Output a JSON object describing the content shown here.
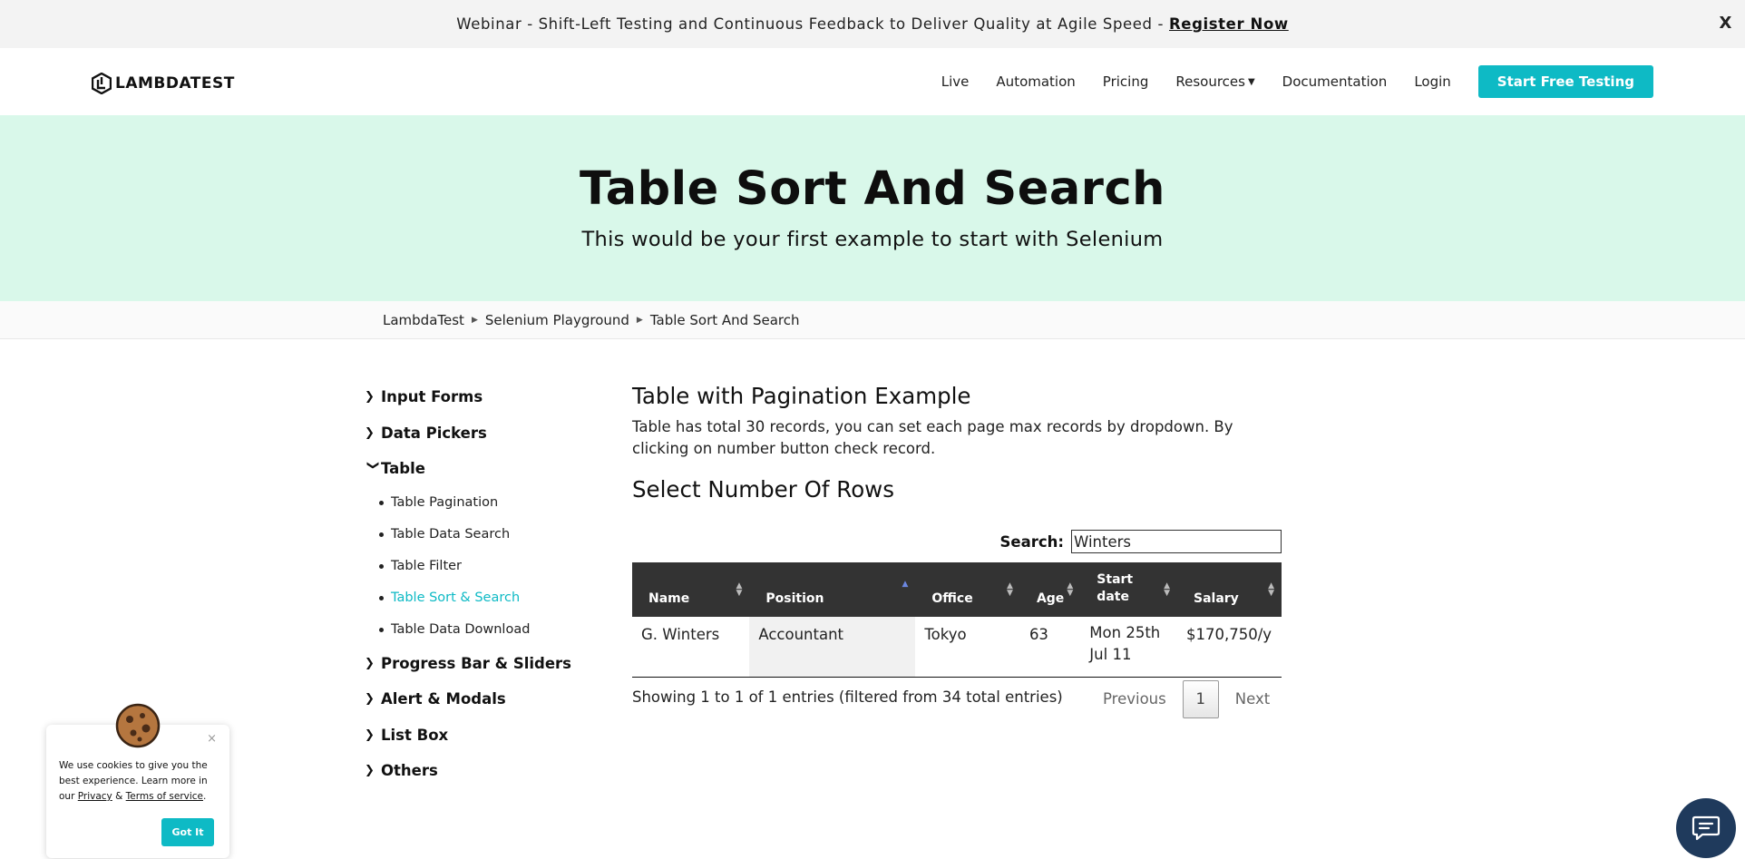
{
  "announcement": {
    "text": "Webinar - Shift-Left Testing and Continuous Feedback to Deliver Quality at Agile Speed -",
    "link": "Register Now",
    "close": "X"
  },
  "nav": {
    "logo": "LAMBDATEST",
    "items": [
      "Live",
      "Automation",
      "Pricing",
      "Resources",
      "Documentation",
      "Login"
    ],
    "cta": "Start Free Testing"
  },
  "hero": {
    "title": "Table Sort And Search",
    "subtitle": "This would be your first example to start with Selenium"
  },
  "breadcrumb": [
    "LambdaTest",
    "Selenium Playground",
    "Table Sort And Search"
  ],
  "sidebar": {
    "categories": [
      {
        "label": "Input Forms",
        "expanded": false
      },
      {
        "label": "Data Pickers",
        "expanded": false
      },
      {
        "label": "Table",
        "expanded": true,
        "items": [
          "Table Pagination",
          "Table Data Search",
          "Table Filter",
          "Table Sort & Search",
          "Table Data Download"
        ],
        "active": "Table Sort & Search"
      },
      {
        "label": "Progress Bar & Sliders",
        "expanded": false
      },
      {
        "label": "Alert & Modals",
        "expanded": false
      },
      {
        "label": "List Box",
        "expanded": false
      },
      {
        "label": "Others",
        "expanded": false
      }
    ]
  },
  "main": {
    "heading": "Table with Pagination Example",
    "description": "Table has total 30 records, you can set each page max records by dropdown. By clicking on number button check record.",
    "subheading": "Select Number Of Rows",
    "search_label": "Search:",
    "search_value": "Winters"
  },
  "table": {
    "headers": [
      "Name",
      "Position",
      "Office",
      "Age",
      "Start date",
      "Salary"
    ],
    "sorted_column": "Position",
    "rows": [
      {
        "name": "G. Winters",
        "position": "Accountant",
        "office": "Tokyo",
        "age": "63",
        "start_date": "Mon 25th Jul 11",
        "salary": "$170,750/y"
      }
    ]
  },
  "pagination": {
    "info": "Showing 1 to 1 of 1 entries (filtered from 34 total entries)",
    "previous": "Previous",
    "current_page": "1",
    "next": "Next"
  },
  "cookie": {
    "text_1": "We use cookies to give you the best experience. Learn more in our",
    "privacy": "Privacy",
    "amp": "&",
    "terms": "Terms of service",
    "period": ".",
    "button": "Got It",
    "close": "×"
  },
  "colors": {
    "accent": "#0ebac5",
    "hero_bg": "#d9f8ea",
    "table_header": "#333333",
    "chat": "#1f3a5c"
  },
  "icons": [
    "close-icon",
    "chevron-down-icon",
    "chevron-right-icon",
    "sort-icon",
    "cookie-icon",
    "chat-icon"
  ]
}
